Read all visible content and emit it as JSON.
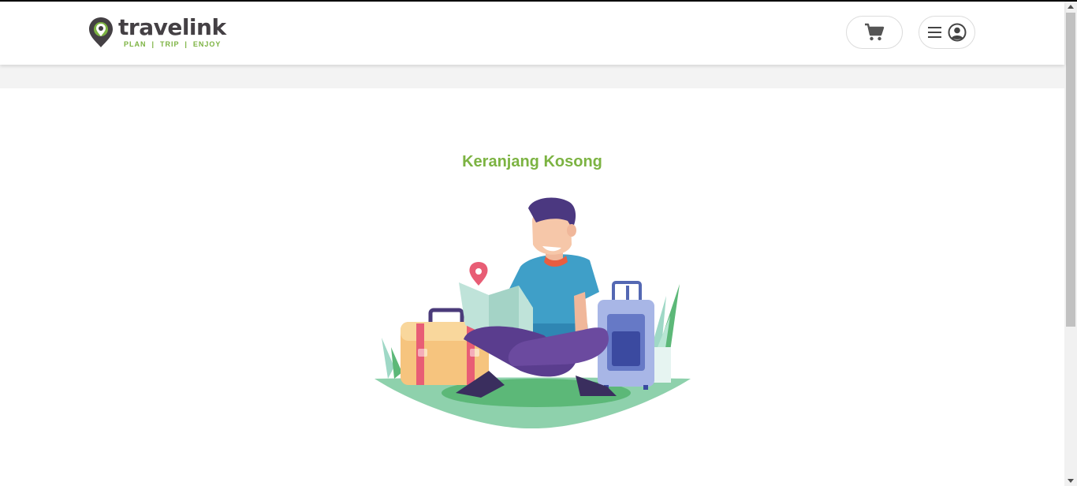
{
  "header": {
    "brand": "travelink",
    "tagline": "PLAN  |  TRIP  |  ENJOY",
    "cart_icon": "shopping-cart-icon",
    "menu_icon": "hamburger-menu-icon",
    "account_icon": "user-circle-icon"
  },
  "main": {
    "empty_title": "Keranjang Kosong",
    "illustration": "traveler-sitting-with-map-and-luggage"
  },
  "colors": {
    "accent_green": "#7cb342",
    "logo_dark": "#444044",
    "pin_red": "#e85d75"
  }
}
